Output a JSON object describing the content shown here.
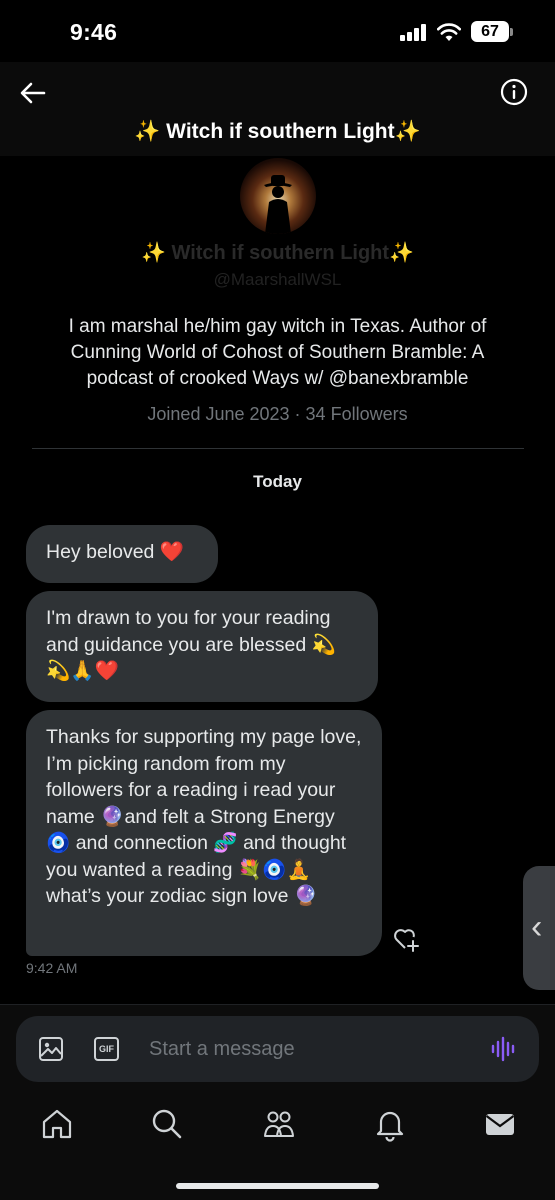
{
  "status": {
    "time": "9:46",
    "battery": "67"
  },
  "header": {
    "title": "✨ Witch if southern Light✨"
  },
  "profile": {
    "name": "✨ Witch if southern Light✨",
    "handle": "@MaarshallWSL",
    "bio": "I am marshal he/him gay witch in Texas. Author of Cunning World of Cohost of Southern Bramble: A podcast of crooked Ways  w/ @banexbramble",
    "joined": "Joined June 2023",
    "followers": "34 Followers"
  },
  "conversation": {
    "date_label": "Today",
    "messages": [
      {
        "text": "Hey beloved ❤️"
      },
      {
        "text": "I'm drawn to you for your reading and guidance you are blessed 💫💫🙏❤️"
      },
      {
        "text": "Thanks for supporting my page love,  I’m picking random from my followers for a reading i read your name 🔮and felt a Strong Energy 🧿 and connection 🧬 and thought you wanted a reading 💐🧿🧘 what’s your zodiac sign love 🔮"
      }
    ],
    "timestamp": "9:42 AM"
  },
  "composer": {
    "placeholder": "Start a message",
    "gif_label": "GIF"
  },
  "colors": {
    "background": "#000000",
    "bubble": "#2f3336",
    "muted": "#71767b",
    "accent_voice": "#8b5cf6"
  },
  "tabs": [
    "home-icon",
    "search-icon",
    "communities-icon",
    "notifications-icon",
    "messages-icon"
  ]
}
